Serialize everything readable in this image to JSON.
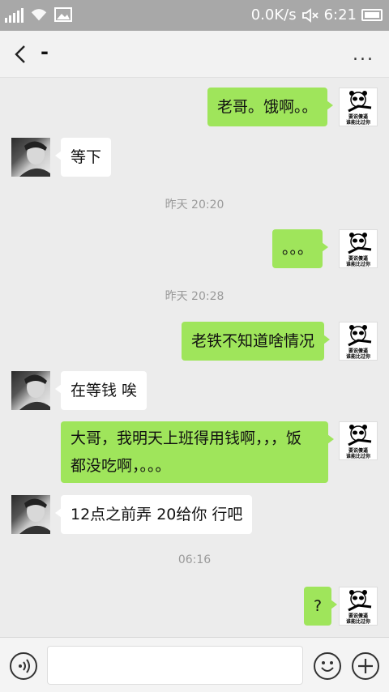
{
  "status_bar": {
    "network_speed": "0.0K/s",
    "time": "6:21",
    "icons": [
      "signal-icon",
      "wifi-icon",
      "image-icon",
      "mute-icon",
      "battery-icon"
    ]
  },
  "header": {
    "back_icon": "back-chevron-icon",
    "title": "-",
    "more_label": "..."
  },
  "self_avatar_caption": [
    "要说傻逼",
    "谁能比过你"
  ],
  "messages": [
    {
      "side": "right",
      "text": "老哥。饿啊。。"
    },
    {
      "side": "left",
      "text": "等下"
    },
    {
      "type": "time",
      "text": "昨天 20:20"
    },
    {
      "side": "right",
      "text": "。。。"
    },
    {
      "type": "time",
      "text": "昨天 20:28"
    },
    {
      "side": "right",
      "text": "老铁不知道啥情况"
    },
    {
      "side": "left",
      "text": "在等钱 唉"
    },
    {
      "side": "right",
      "text": "大哥，我明天上班得用钱啊，，，饭",
      "text2": "都没吃啊，。。。"
    },
    {
      "side": "left",
      "text": "12点之前弄 20给你 行吧"
    },
    {
      "type": "time",
      "text": "06:16"
    },
    {
      "side": "right",
      "text": "?"
    }
  ],
  "input_bar": {
    "placeholder": "",
    "icons": [
      "voice-icon",
      "emoji-icon",
      "plus-icon"
    ]
  },
  "colors": {
    "sent_bubble": "#9fe55b",
    "received_bubble": "#ffffff",
    "chat_background": "#ececec",
    "status_bar": "#a8a8a8"
  }
}
